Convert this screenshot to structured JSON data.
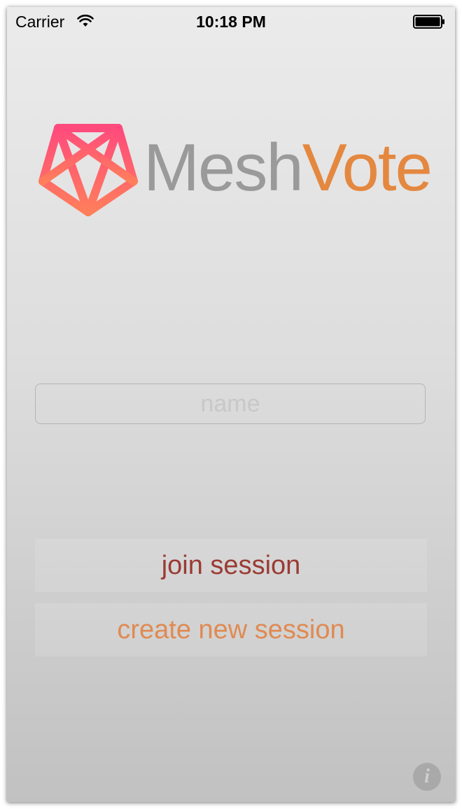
{
  "status_bar": {
    "carrier": "Carrier",
    "time": "10:18 PM",
    "wifi_icon": "wifi-icon",
    "battery_icon": "battery-icon"
  },
  "logo": {
    "icon": "pentagon-mesh-icon",
    "brand_part1": "Mesh",
    "brand_part2": "Vote",
    "colors": {
      "mesh": "#9a9a9a",
      "vote": "#e48840",
      "icon_top": "#ff4a7d",
      "icon_bottom": "#ff7c5c"
    }
  },
  "form": {
    "name_placeholder": "name",
    "name_value": ""
  },
  "buttons": {
    "join_label": "join session",
    "create_label": "create new session",
    "colors": {
      "join": "#9a3b34",
      "create": "#e08a52"
    }
  },
  "footer": {
    "info_icon": "info-icon",
    "info_glyph": "i"
  }
}
